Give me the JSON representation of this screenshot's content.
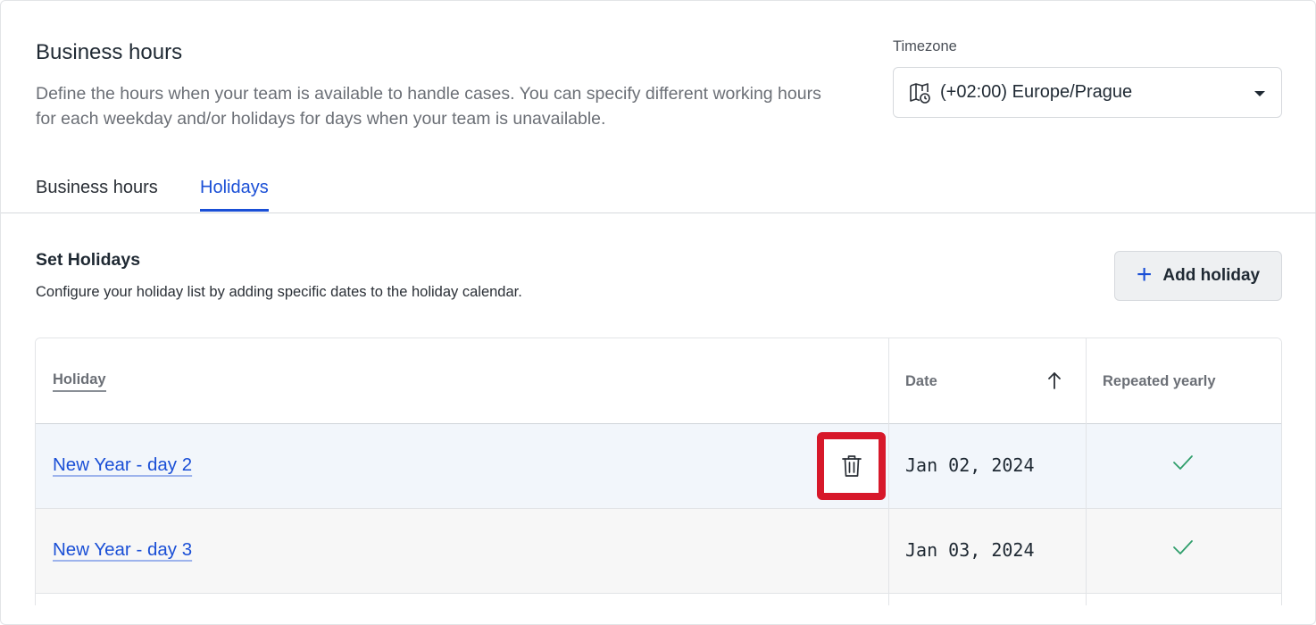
{
  "header": {
    "title": "Business hours",
    "description": "Define the hours when your team is available to handle cases. You can specify different working hours for each weekday and/or holidays for days when your team is unavailable."
  },
  "timezone": {
    "label": "Timezone",
    "value": "(+02:00) Europe/Prague",
    "icon": "map-clock-icon"
  },
  "tabs": [
    {
      "label": "Business hours",
      "active": false
    },
    {
      "label": "Holidays",
      "active": true
    }
  ],
  "holidays_section": {
    "title": "Set Holidays",
    "description": "Configure your holiday list by adding specific dates to the holiday calendar.",
    "add_button_label": "Add holiday"
  },
  "table": {
    "columns": {
      "holiday": "Holiday",
      "date": "Date",
      "repeated": "Repeated yearly"
    },
    "sort": {
      "column": "Date",
      "direction": "ascending"
    },
    "rows": [
      {
        "name": "New Year - day 2",
        "date": "Jan 02, 2024",
        "repeated_yearly": true
      },
      {
        "name": "New Year - day 3",
        "date": "Jan 03, 2024",
        "repeated_yearly": true
      }
    ]
  },
  "colors": {
    "accent": "#1a4fd6",
    "check": "#2f9e6b",
    "highlight": "#d7182a"
  }
}
